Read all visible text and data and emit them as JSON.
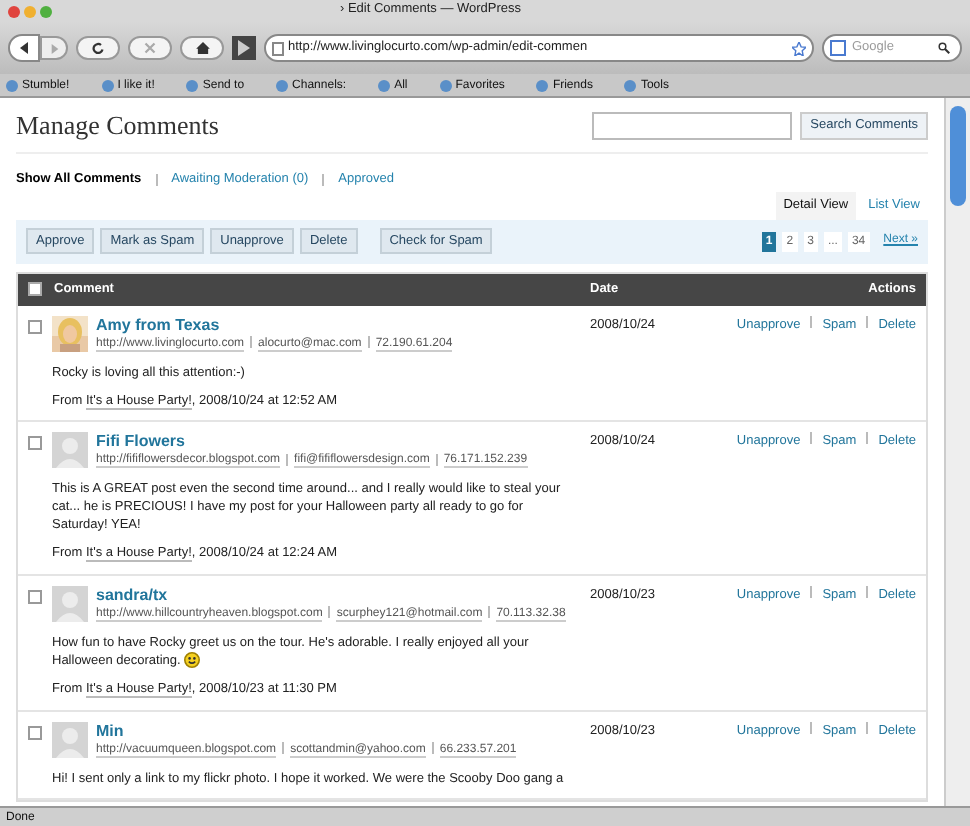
{
  "window": {
    "title": "› Edit Comments — WordPress"
  },
  "toolbar": {
    "url": "http://www.livinglocurto.com/wp-admin/edit-commen",
    "search_placeholder": "Google"
  },
  "bookmarks": [
    {
      "label": "Stumble!"
    },
    {
      "label": "I like it!"
    },
    {
      "label": "Send to"
    },
    {
      "label": "Channels:"
    },
    {
      "label": "All"
    },
    {
      "label": "Favorites"
    },
    {
      "label": "Friends"
    },
    {
      "label": "Tools"
    }
  ],
  "page": {
    "title": "Manage Comments",
    "search_button": "Search Comments",
    "filters": [
      {
        "label": "Show All Comments",
        "selected": true
      },
      {
        "label": "Awaiting Moderation (0)",
        "selected": false
      },
      {
        "label": "Approved",
        "selected": false
      }
    ],
    "views": [
      {
        "label": "Detail View",
        "selected": true
      },
      {
        "label": "List View",
        "selected": false
      }
    ],
    "bulk_buttons": [
      "Approve",
      "Mark as Spam",
      "Unapprove",
      "Delete",
      "Check for Spam"
    ],
    "pagination": [
      {
        "label": "1",
        "selected": true
      },
      {
        "label": "2",
        "selected": false
      },
      {
        "label": "3",
        "selected": false
      },
      {
        "label": "...",
        "selected": false
      },
      {
        "label": "34",
        "selected": false
      }
    ],
    "next": "Next »",
    "columns": [
      "Comment",
      "Date",
      "Actions"
    ],
    "select_all_checked": false,
    "comments": [
      {
        "author": "Amy from Texas",
        "has_photo": true,
        "url": "http://www.livinglocurto.com",
        "email": "alocurto@mac.com",
        "ip": "72.190.61.204",
        "text": "Rocky is loving all this attention:-)",
        "smiley": false,
        "from": "From",
        "post": "It's a House Party!",
        "when": ", 2008/10/24 at 12:52 AM",
        "date": "2008/10/24",
        "actions": [
          "Unapprove",
          "Spam",
          "Delete"
        ],
        "checked": false
      },
      {
        "author": "Fifi Flowers",
        "has_photo": false,
        "url": "http://fififlowersdecor.blogspot.com",
        "email": "fifi@fififlowersdesign.com",
        "ip": "76.171.152.239",
        "text": "This is A GREAT post even the second time around... and I really would like to steal your cat... he is PRECIOUS! I have my post for your Halloween party all ready to go for Saturday! YEA!",
        "smiley": false,
        "from": "From",
        "post": "It's a House Party!",
        "when": ", 2008/10/24 at 12:24 AM",
        "date": "2008/10/24",
        "actions": [
          "Unapprove",
          "Spam",
          "Delete"
        ],
        "checked": false
      },
      {
        "author": "sandra/tx",
        "has_photo": false,
        "url": "http://www.hillcountryheaven.blogspot.com",
        "email": "scurphey121@hotmail.com",
        "ip": "70.113.32.38",
        "text": "How fun to have Rocky greet us on the tour. He's adorable. I really enjoyed all your Halloween decorating.",
        "smiley": true,
        "from": "From",
        "post": "It's a House Party!",
        "when": ", 2008/10/23 at 11:30 PM",
        "date": "2008/10/23",
        "actions": [
          "Unapprove",
          "Spam",
          "Delete"
        ],
        "checked": false
      },
      {
        "author": "Min",
        "has_photo": false,
        "url": "http://vacuumqueen.blogspot.com",
        "email": "scottandmin@yahoo.com",
        "ip": "66.233.57.201",
        "text": "Hi! I sent only a link to my flickr photo. I hope it worked. We were the Scooby Doo gang a",
        "smiley": false,
        "date": "2008/10/23",
        "actions": [
          "Unapprove",
          "Spam",
          "Delete"
        ],
        "checked": false
      }
    ]
  },
  "status": "Done"
}
